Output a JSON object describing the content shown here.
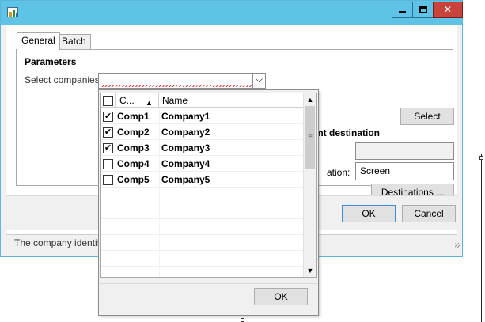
{
  "window": {
    "title": ""
  },
  "tabs": [
    {
      "label": "General"
    },
    {
      "label": "Batch"
    }
  ],
  "parameters": {
    "title": "Parameters",
    "select_companies_label": "Select companies:"
  },
  "buttons": {
    "select": "Select",
    "destinations": "Destinations ...",
    "ok": "OK",
    "cancel": "Cancel",
    "popup_ok": "OK"
  },
  "print": {
    "title": "int destination",
    "destination_label": "ation:",
    "destination_value": "Screen"
  },
  "status": {
    "text": "The company identifi"
  },
  "popup": {
    "columns": [
      {
        "label": "C..."
      },
      {
        "label": "Name"
      }
    ],
    "rows": [
      {
        "code": "Comp1",
        "name": "Company1",
        "checked": true
      },
      {
        "code": "Comp2",
        "name": "Company2",
        "checked": true
      },
      {
        "code": "Comp3",
        "name": "Company3",
        "checked": true
      },
      {
        "code": "Comp4",
        "name": "Company4",
        "checked": false
      },
      {
        "code": "Comp5",
        "name": "Company5",
        "checked": false
      }
    ],
    "empty_row_count": 6
  }
}
